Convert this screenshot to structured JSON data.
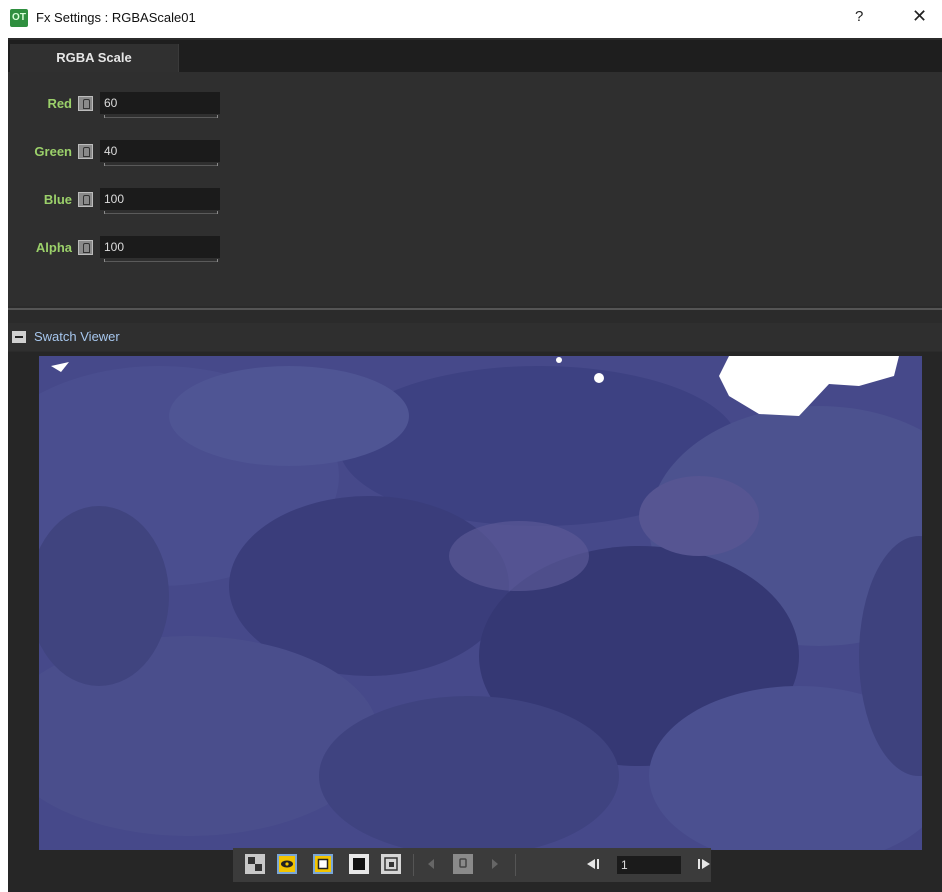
{
  "window": {
    "app_icon_text": "OT",
    "title": "Fx Settings : RGBAScale01",
    "help_label": "?",
    "close_label": "✕"
  },
  "tabs": [
    {
      "label": "RGBA Scale",
      "active": true
    }
  ],
  "params": [
    {
      "label": "Red",
      "value": "60"
    },
    {
      "label": "Green",
      "value": "40"
    },
    {
      "label": "Blue",
      "value": "100"
    },
    {
      "label": "Alpha",
      "value": "100"
    }
  ],
  "swatch_viewer": {
    "title": "Swatch Viewer"
  },
  "toolbar": {
    "buttons": [
      {
        "icon": "checkerboard-icon"
      },
      {
        "icon": "preview-eye-icon",
        "active": true
      },
      {
        "icon": "white-bg-icon",
        "active": true
      },
      {
        "icon": "black-bg-icon"
      },
      {
        "icon": "camera-box-icon"
      },
      {
        "icon": "prev-key-icon"
      },
      {
        "icon": "key-icon"
      },
      {
        "icon": "next-key-icon"
      },
      {
        "icon": "prev-frame-icon"
      },
      {
        "icon": "next-frame-icon"
      }
    ],
    "frame_value": "1"
  },
  "colors": {
    "param_label": "#9bd06a",
    "swatch_title": "#a7c7ee",
    "image_base": "#46498a",
    "active_toggle": "#f2c400"
  }
}
